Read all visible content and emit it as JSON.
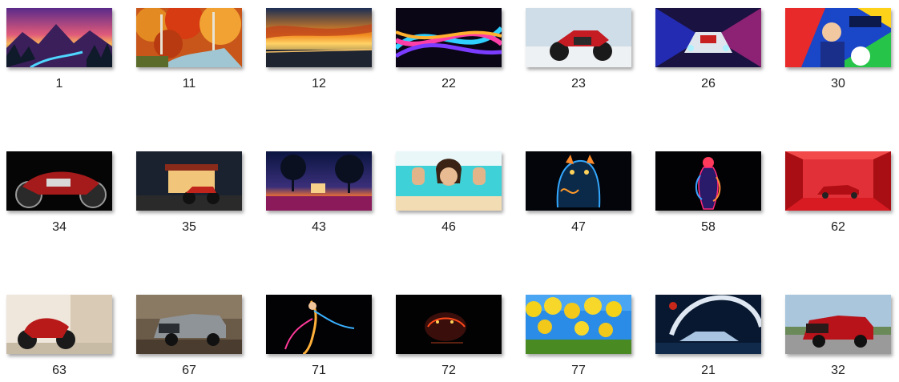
{
  "files": [
    {
      "label": "1",
      "subject": "purple mountain sunset landscape"
    },
    {
      "label": "11",
      "subject": "autumn forest with stream"
    },
    {
      "label": "12",
      "subject": "dramatic sunset over sea"
    },
    {
      "label": "22",
      "subject": "neon light streaks"
    },
    {
      "label": "23",
      "subject": "red sport motorcycle on salt flat"
    },
    {
      "label": "26",
      "subject": "racing car with speed lights"
    },
    {
      "label": "30",
      "subject": "football game cover art"
    },
    {
      "label": "34",
      "subject": "red cruiser motorcycle on black"
    },
    {
      "label": "35",
      "subject": "motorcycle at night store"
    },
    {
      "label": "43",
      "subject": "night sky with trees and cottage"
    },
    {
      "label": "46",
      "subject": "woman at beach"
    },
    {
      "label": "47",
      "subject": "neon panther"
    },
    {
      "label": "58",
      "subject": "neon figure on black"
    },
    {
      "label": "62",
      "subject": "red car in red room"
    },
    {
      "label": "63",
      "subject": "red motorcycle in street"
    },
    {
      "label": "67",
      "subject": "gray pickup truck"
    },
    {
      "label": "71",
      "subject": "colorful light figure on black"
    },
    {
      "label": "72",
      "subject": "glowing tiger on black"
    },
    {
      "label": "77",
      "subject": "yellow tulips and blue sky"
    },
    {
      "label": "21",
      "subject": "futuristic car in space"
    },
    {
      "label": "32",
      "subject": "red pickup truck"
    }
  ]
}
